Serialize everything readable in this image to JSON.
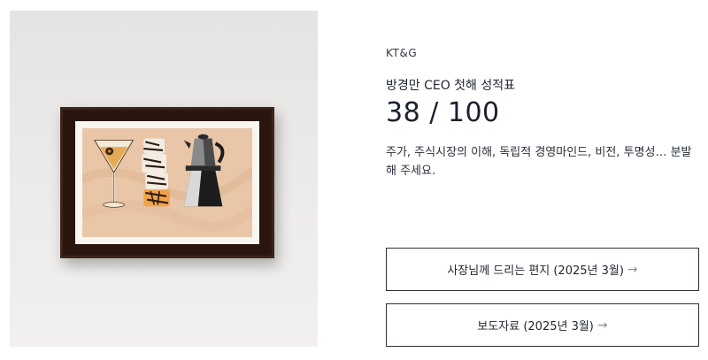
{
  "brand": "KT&G",
  "subtitle": "방경만 CEO 첫해 성적표",
  "score": "38 / 100",
  "description": "주가, 주식시장의 이해, 독립적 경영마인드, 비전, 투명성… 분발해 주세요.",
  "buttons": {
    "letter_label": "사장님께 드리는 편지 (2025년 3월)",
    "press_label": "보도자료 (2025년 3월)",
    "arrow": "→"
  },
  "artwork": {
    "icons": [
      "martini-glass-icon",
      "tiger-striped-tower-icon",
      "moka-pot-icon"
    ],
    "frame_color": "#2b160f",
    "print_color": "#e9c6a7"
  }
}
